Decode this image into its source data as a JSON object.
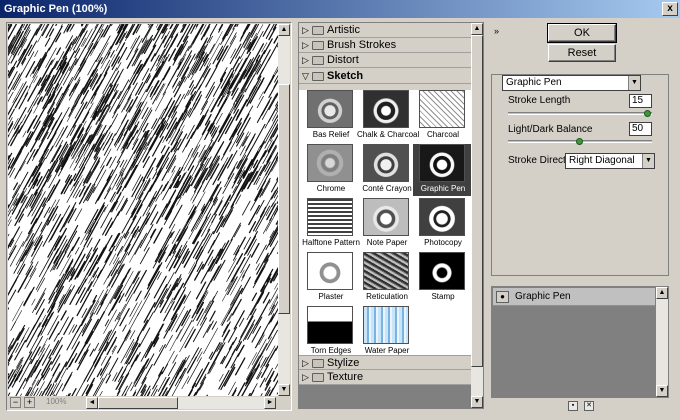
{
  "window": {
    "title": "Graphic Pen (100%)",
    "close": "x"
  },
  "preview": {
    "zoom": "100%",
    "minus": "−",
    "plus": "+",
    "arrow_up": "▲",
    "arrow_down": "▼",
    "arrow_left": "◄",
    "arrow_right": "►"
  },
  "gallery": {
    "categories": [
      {
        "label": "Artistic",
        "arrow": "▷"
      },
      {
        "label": "Brush Strokes",
        "arrow": "▷"
      },
      {
        "label": "Distort",
        "arrow": "▷"
      },
      {
        "label": "Sketch",
        "arrow": "▽"
      },
      {
        "label": "Stylize",
        "arrow": "▷"
      },
      {
        "label": "Texture",
        "arrow": "▷"
      }
    ],
    "filters": [
      {
        "name": "Bas Relief"
      },
      {
        "name": "Chalk & Charcoal"
      },
      {
        "name": "Charcoal"
      },
      {
        "name": "Chrome"
      },
      {
        "name": "Conté Crayon"
      },
      {
        "name": "Graphic Pen"
      },
      {
        "name": "Halftone Pattern"
      },
      {
        "name": "Note Paper"
      },
      {
        "name": "Photocopy"
      },
      {
        "name": "Plaster"
      },
      {
        "name": "Reticulation"
      },
      {
        "name": "Stamp"
      },
      {
        "name": "Torn Edges"
      },
      {
        "name": "Water Paper"
      }
    ],
    "selected": "Graphic Pen"
  },
  "buttons": {
    "ok": "OK",
    "reset": "Reset",
    "collapse": "»"
  },
  "settings": {
    "filter_select": "Graphic Pen",
    "stroke_length_label": "Stroke Length",
    "stroke_length_value": "15",
    "stroke_length_fraction": 1.0,
    "balance_label": "Light/Dark Balance",
    "balance_value": "50",
    "balance_fraction": 0.5,
    "direction_label": "Stroke Direction:",
    "direction_value": "Right Diagonal"
  },
  "layers": {
    "items": [
      {
        "name": "Graphic Pen"
      }
    ],
    "new_icon": "▪",
    "delete_icon": "✕"
  },
  "colors": {
    "dialog": "#d4d0c8",
    "title_start": "#0a246a",
    "title_end": "#a6caf0",
    "knob": "#3c9a3c"
  }
}
